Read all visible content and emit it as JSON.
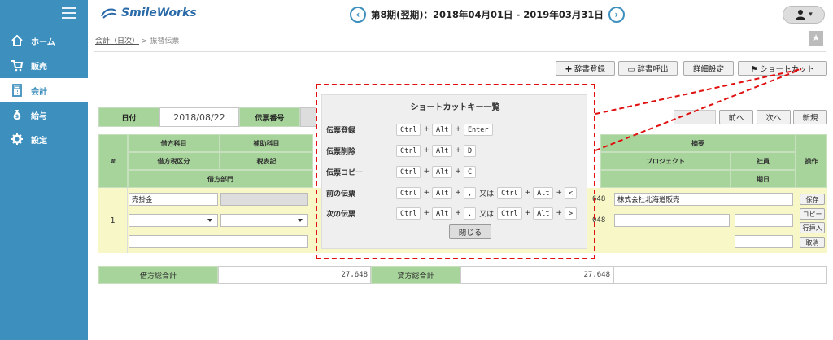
{
  "sidebar": {
    "items": [
      {
        "label": "ホーム",
        "icon": "home-icon"
      },
      {
        "label": "販売",
        "icon": "cart-icon"
      },
      {
        "label": "会計",
        "icon": "calculator-icon",
        "active": true
      },
      {
        "label": "給与",
        "icon": "money-bag-icon"
      },
      {
        "label": "設定",
        "icon": "gear-icon"
      }
    ]
  },
  "header": {
    "logo": "SmileWorks",
    "period": "第8期(翌期)：2018年04月01日 - 2019年03月31日",
    "prev_icon": "chevron-left-icon",
    "next_icon": "chevron-right-icon",
    "user_icon": "user-icon"
  },
  "breadcrumb": {
    "parent": "会計（日次）",
    "sep": ">",
    "current": "振替伝票"
  },
  "toolbar": {
    "dict_register": "✚ 辞書登録",
    "dict_call": "▭ 辞書呼出",
    "detail": "詳細設定",
    "shortcut": "⚑ ショートカット"
  },
  "form": {
    "date_label": "日付",
    "date_value": "2018/08/22",
    "voucher_label": "伝票番号",
    "prev": "前へ",
    "next": "次へ",
    "new": "新規"
  },
  "grid": {
    "headers": {
      "no": "#",
      "debit_account": "借方科目",
      "sub_account": "補助科目",
      "debit_tax": "借方税区分",
      "tax_table": "税表記",
      "debit_dept": "借方部門",
      "summary": "摘要",
      "project": "プロジェクト",
      "employee": "社員",
      "due": "期日",
      "action": "操作"
    },
    "row": {
      "no": "1",
      "debit_account": "売掛金",
      "amount1": "648",
      "amount2": "048",
      "summary": "株式会社北海道販売"
    },
    "actions": {
      "save": "保存",
      "copy": "コピー",
      "insert": "行挿入",
      "cancel": "取消"
    }
  },
  "totals": {
    "debit_label": "借方総合計",
    "debit_value": "27,648",
    "credit_label": "貸方総合計",
    "credit_value": "27,648"
  },
  "popup": {
    "title": "ショートカットキー一覧",
    "rows": [
      {
        "name": "伝票登録",
        "k1": "Ctrl",
        "k2": "Alt",
        "k3": "Enter"
      },
      {
        "name": "伝票削除",
        "k1": "Ctrl",
        "k2": "Alt",
        "k3": "D"
      },
      {
        "name": "伝票コピー",
        "k1": "Ctrl",
        "k2": "Alt",
        "k3": "C"
      },
      {
        "name": "前の伝票",
        "k1": "Ctrl",
        "k2": "Alt",
        "k3": ",",
        "or": "又は",
        "k4": "Ctrl",
        "k5": "Alt",
        "k6": "<"
      },
      {
        "name": "次の伝票",
        "k1": "Ctrl",
        "k2": "Alt",
        "k3": ".",
        "or": "又は",
        "k4": "Ctrl",
        "k5": "Alt",
        "k6": ">"
      }
    ],
    "close": "閉じる"
  },
  "colors": {
    "sidebar": "#3d8fbe",
    "label_green": "#a6d49a",
    "annotation_red": "#e01010"
  }
}
